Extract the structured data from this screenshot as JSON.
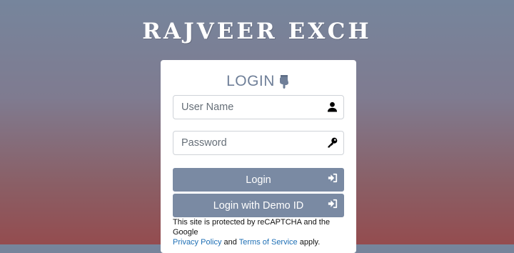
{
  "brand": {
    "logo_text": "RAJVEER EXCH"
  },
  "login": {
    "title": "LOGIN",
    "username": {
      "placeholder": "User Name",
      "value": ""
    },
    "password": {
      "placeholder": "Password",
      "value": ""
    },
    "login_button": "Login",
    "demo_button": "Login with Demo ID"
  },
  "recaptcha": {
    "text_before": "This site is protected by reCAPTCHA and the Google",
    "privacy_link": "Privacy Policy",
    "and_text": "and",
    "terms_link": "Terms of Service",
    "text_after": "apply."
  },
  "colors": {
    "accent": "#7a8aa3",
    "heading": "#6f7f98",
    "link": "#1e6fb5",
    "background_top": "#76859c",
    "background_bottom": "#944c4f"
  },
  "icons": {
    "title": "hand-pointing-down-icon",
    "username": "user-icon",
    "password": "key-icon",
    "buttons": "sign-in-icon"
  }
}
